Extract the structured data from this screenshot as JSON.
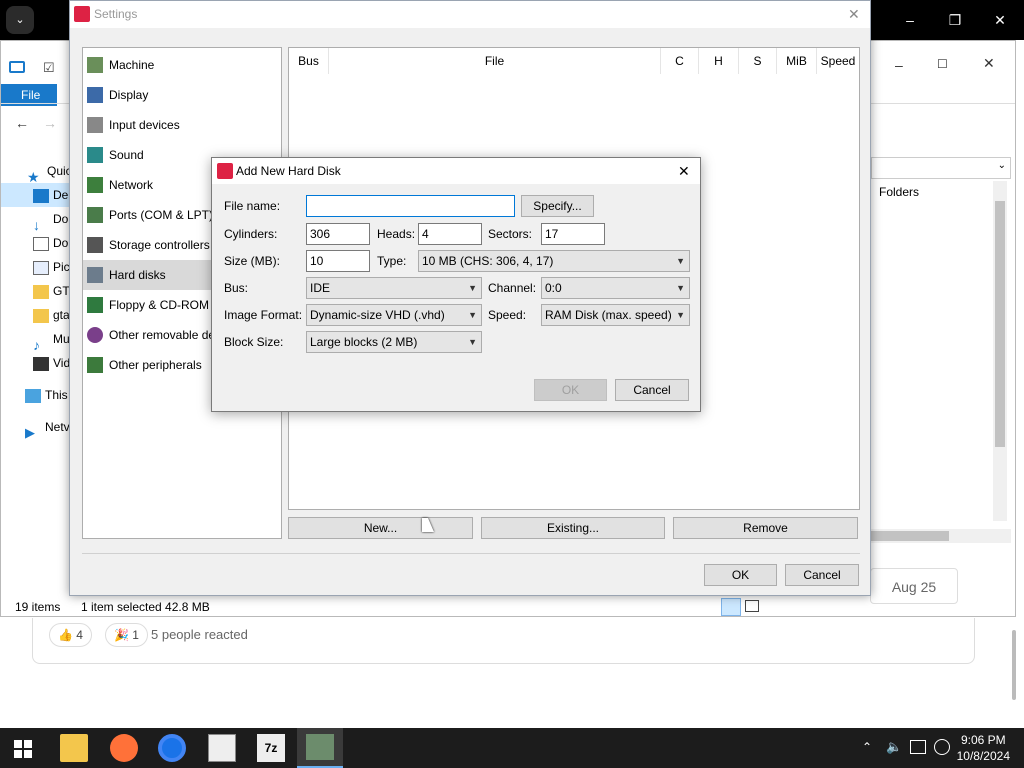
{
  "explorer": {
    "file_tab": "File",
    "nav": [
      "Quic",
      "De",
      "Do",
      "Do",
      "Pic",
      "GT",
      "gta",
      "Mu",
      "Vid",
      "This",
      "Netv"
    ],
    "folders_header": "Folders",
    "status_count": "19 items",
    "status_selection": "1 item selected  42.8 MB"
  },
  "reactions": {
    "like_count": "4",
    "second_count": "1",
    "summary": "5 people reacted",
    "date": "Aug 25"
  },
  "settings": {
    "title": "Settings",
    "categories": [
      "Machine",
      "Display",
      "Input devices",
      "Sound",
      "Network",
      "Ports (COM & LPT)",
      "Storage controllers",
      "Hard disks",
      "Floppy & CD-ROM",
      "Other removable de",
      "Other peripherals"
    ],
    "selected_category": "Hard disks",
    "table_headers": [
      "Bus",
      "File",
      "C",
      "H",
      "S",
      "MiB",
      "Speed"
    ],
    "new_button": "New...",
    "existing_button": "Existing...",
    "remove_button": "Remove",
    "ok_button": "OK",
    "cancel_button": "Cancel"
  },
  "dialog": {
    "title": "Add New Hard Disk",
    "file_name_label": "File name:",
    "file_name_value": "",
    "specify_button": "Specify...",
    "cylinders_label": "Cylinders:",
    "cylinders_value": "306",
    "heads_label": "Heads:",
    "heads_value": "4",
    "sectors_label": "Sectors:",
    "sectors_value": "17",
    "size_label": "Size (MB):",
    "size_value": "10",
    "type_label": "Type:",
    "type_value": "10 MB (CHS: 306, 4, 17)",
    "bus_label": "Bus:",
    "bus_value": "IDE",
    "channel_label": "Channel:",
    "channel_value": "0:0",
    "image_format_label": "Image Format:",
    "image_format_value": "Dynamic-size VHD (.vhd)",
    "speed_label": "Speed:",
    "speed_value": "RAM Disk (max. speed)",
    "block_size_label": "Block Size:",
    "block_size_value": "Large blocks (2 MB)",
    "ok_button": "OK",
    "cancel_button": "Cancel"
  },
  "taskbar": {
    "time": "9:06 PM",
    "date": "10/8/2024",
    "apps": [
      "file-explorer",
      "firefox",
      "chrome",
      "86box-manager",
      "7zip",
      "86box"
    ]
  }
}
